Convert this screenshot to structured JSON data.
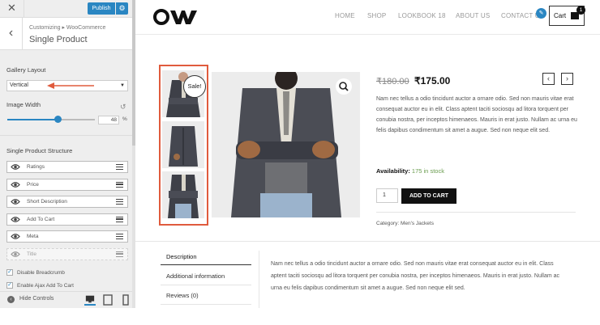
{
  "customizer": {
    "publish_label": "Publish",
    "close_icon": "close-icon",
    "breadcrumb": "Customizing ▸ WooCommerce",
    "title": "Single Product",
    "gallery_layout_label": "Gallery Layout",
    "gallery_layout_value": "Vertical",
    "image_width_label": "Image Width",
    "image_width_value": "48",
    "image_width_unit": "%",
    "image_width_fraction": 0.48,
    "structure_label": "Single Product Structure",
    "structure_items": [
      {
        "label": "Ratings",
        "visible": true
      },
      {
        "label": "Price",
        "visible": true
      },
      {
        "label": "Short Description",
        "visible": true
      },
      {
        "label": "Add To Cart",
        "visible": true
      },
      {
        "label": "Meta",
        "visible": true
      },
      {
        "label": "Title",
        "visible": false
      }
    ],
    "checkbox_1": "Disable Breadcrumb",
    "checkbox_2": "Enable Ajax Add To Cart",
    "hide_controls": "Hide Controls",
    "accent_color": "#2a86c2",
    "arrow_color": "#e05b3d"
  },
  "site": {
    "nav": [
      "HOME",
      "SHOP",
      "LOOKBOOK 18",
      "ABOUT US",
      "CONTACT U"
    ],
    "cart_label": "Cart",
    "cart_count": "1",
    "sale_badge": "Sale!",
    "price_old": "₹180.00",
    "price_new": "₹175.00",
    "prev_label": "‹",
    "next_label": "›",
    "short_description": "Nam nec tellus a odio tincidunt auctor a ornare odio. Sed non mauris vitae erat consequat auctor eu in elit. Class aptent taciti sociosqu ad litora torquent per conubia nostra, per inceptos himenaeos. Mauris in erat justo. Nullam ac urna eu felis dapibus condimentum sit amet a augue. Sed non neque elit sed.",
    "availability_label": "Availability:",
    "availability_value": "175 in stock",
    "quantity": "1",
    "add_to_cart": "ADD TO CART",
    "category": "Category: Men's Jackets",
    "tabs": [
      "Description",
      "Additional information",
      "Reviews (0)"
    ],
    "tab_content": "Nam nec tellus a odio tincidunt auctor a ornare odio. Sed non mauris vitae erat consequat auctor eu in elit. Class aptent taciti sociosqu ad litora torquent per conubia nostra, per inceptos himenaeos. Mauris in erat justo. Nullam ac urna eu felis dapibus condimentum sit amet a augue. Sed non neque elit sed."
  }
}
